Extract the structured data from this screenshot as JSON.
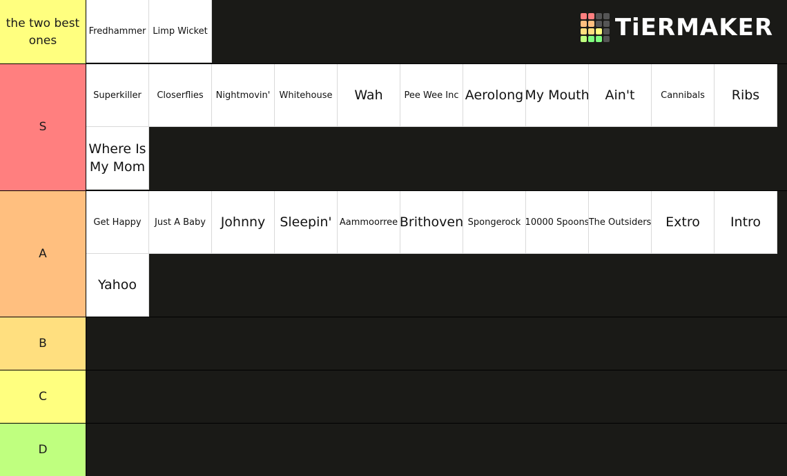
{
  "logo": {
    "text": "TiERMAKER",
    "grid_colors": [
      "#ff7f7f",
      "#ff7f7f",
      "#555555",
      "#555555",
      "#ffbf7f",
      "#ffbf7f",
      "#555555",
      "#555555",
      "#ffdf7f",
      "#ffdf7f",
      "#ffff7f",
      "#555555",
      "#bfff7f",
      "#7fff7f",
      "#7fff7f",
      "#555555"
    ]
  },
  "tiers": [
    {
      "label": "the two best ones",
      "color": "#ffff7f",
      "items": [
        "Fredhammer",
        "Limp Wicket"
      ]
    },
    {
      "label": "S",
      "color": "#ff7f7f",
      "items": [
        "Superkiller",
        "Closerflies",
        "Nightmovin'",
        "Whitehouse",
        "Wah",
        "Pee Wee Inc",
        "Aerolong",
        "My Mouth",
        "Ain't",
        "Cannibals",
        "Ribs",
        "Where Is My Mom"
      ]
    },
    {
      "label": "A",
      "color": "#ffbf7f",
      "items": [
        "Get Happy",
        "Just A Baby",
        "Johnny",
        "Sleepin'",
        "Aammoorree",
        "Brithoven",
        "Spongerock",
        "10000 Spoons",
        "The Outsiders",
        "Extro",
        "Intro",
        "Yahoo"
      ]
    },
    {
      "label": "B",
      "color": "#ffdf7f",
      "items": []
    },
    {
      "label": "C",
      "color": "#ffff7f",
      "items": []
    },
    {
      "label": "D",
      "color": "#bfff7f",
      "items": []
    }
  ]
}
